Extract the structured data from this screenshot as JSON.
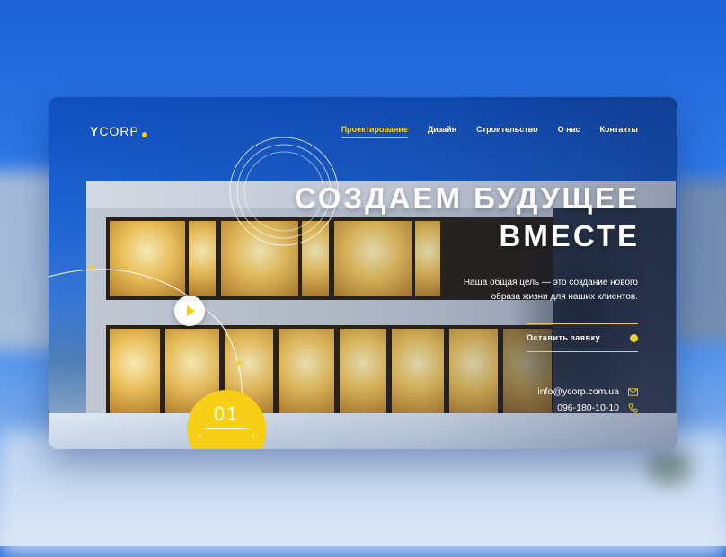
{
  "brand": {
    "name_prefix": "Y",
    "name_rest": "CORP"
  },
  "nav": {
    "items": [
      {
        "label": "Проектирование",
        "active": true
      },
      {
        "label": "Дизайн",
        "active": false
      },
      {
        "label": "Строительство",
        "active": false
      },
      {
        "label": "О нас",
        "active": false
      },
      {
        "label": "Контакты",
        "active": false
      }
    ]
  },
  "hero": {
    "title_line1": "Создаем будущее",
    "title_line2": "вместе",
    "subtitle_line1": "Наша общая цель — это создание нового",
    "subtitle_line2": "образа жизни для наших клиентов.",
    "cta_label": "Оставить заявку"
  },
  "contacts": {
    "email": "info@ycorp.com.ua",
    "phone": "096-180-10-10"
  },
  "slider": {
    "current": "01"
  },
  "icons": {
    "play": "play-icon",
    "email": "envelope-icon",
    "phone": "phone-icon",
    "prev": "chevron-left-icon",
    "next": "chevron-right-icon"
  },
  "colors": {
    "accent": "#f5cf1b",
    "text": "#ffffff",
    "background": "#2f7ae8"
  }
}
